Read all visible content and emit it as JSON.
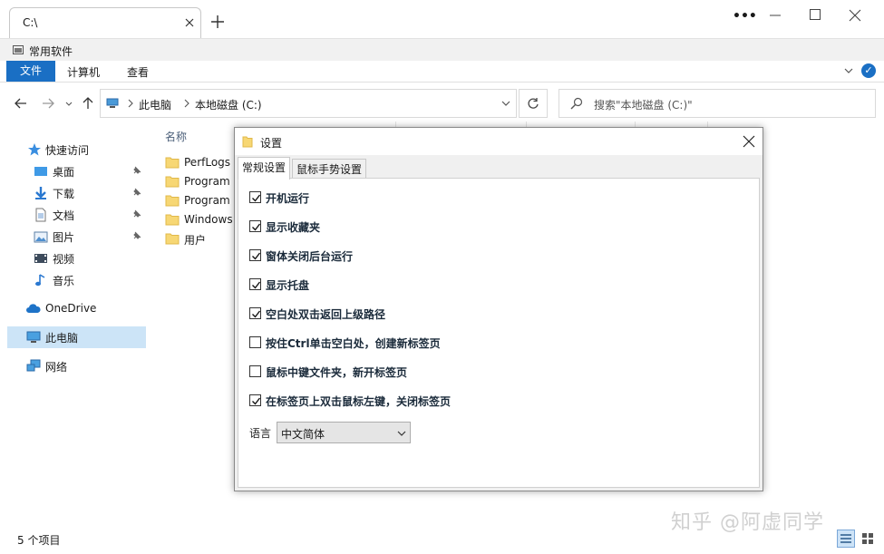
{
  "tab": {
    "title": "C:\\"
  },
  "window": {
    "more": "•••"
  },
  "favorites": {
    "label": "常用软件"
  },
  "ribbon": {
    "file": "文件",
    "computer": "计算机",
    "view": "查看",
    "help": "✓"
  },
  "address": {
    "crumbs": [
      "此电脑",
      "本地磁盘 (C:)"
    ],
    "search_placeholder": "搜索\"本地磁盘 (C:)\""
  },
  "sidebar": {
    "items": [
      {
        "label": "快速访问",
        "icon": "star-icon"
      },
      {
        "label": "桌面",
        "icon": "desktop-icon"
      },
      {
        "label": "下载",
        "icon": "download-icon"
      },
      {
        "label": "文档",
        "icon": "document-icon"
      },
      {
        "label": "图片",
        "icon": "pictures-icon"
      },
      {
        "label": "视频",
        "icon": "video-icon"
      },
      {
        "label": "音乐",
        "icon": "music-icon"
      },
      {
        "label": "OneDrive",
        "icon": "cloud-icon"
      },
      {
        "label": "此电脑",
        "icon": "computer-icon"
      },
      {
        "label": "网络",
        "icon": "network-icon"
      }
    ]
  },
  "list": {
    "column_name": "名称",
    "files": [
      "PerfLogs",
      "Program",
      "Program",
      "Windows",
      "用户"
    ]
  },
  "status": {
    "count": "5 个项目"
  },
  "dialog": {
    "title": "设置",
    "tabs": [
      "常规设置",
      "鼠标手势设置"
    ],
    "options": [
      {
        "label": "开机运行",
        "checked": true
      },
      {
        "label": "显示收藏夹",
        "checked": true
      },
      {
        "label": "窗体关闭后台运行",
        "checked": true
      },
      {
        "label": "显示托盘",
        "checked": true
      },
      {
        "label": "空白处双击返回上级路径",
        "checked": true
      },
      {
        "label": "按住Ctrl单击空白处，创建新标签页",
        "checked": false
      },
      {
        "label": "鼠标中键文件夹，新开标签页",
        "checked": false
      },
      {
        "label": "在标签页上双击鼠标左键，关闭标签页",
        "checked": true
      }
    ],
    "language_label": "语言",
    "language_value": "中文简体"
  },
  "watermark": "知乎 @阿虚同学",
  "colors": {
    "accent": "#1a6fc4",
    "selection": "#cce4f7",
    "folder": "#f7d774"
  }
}
